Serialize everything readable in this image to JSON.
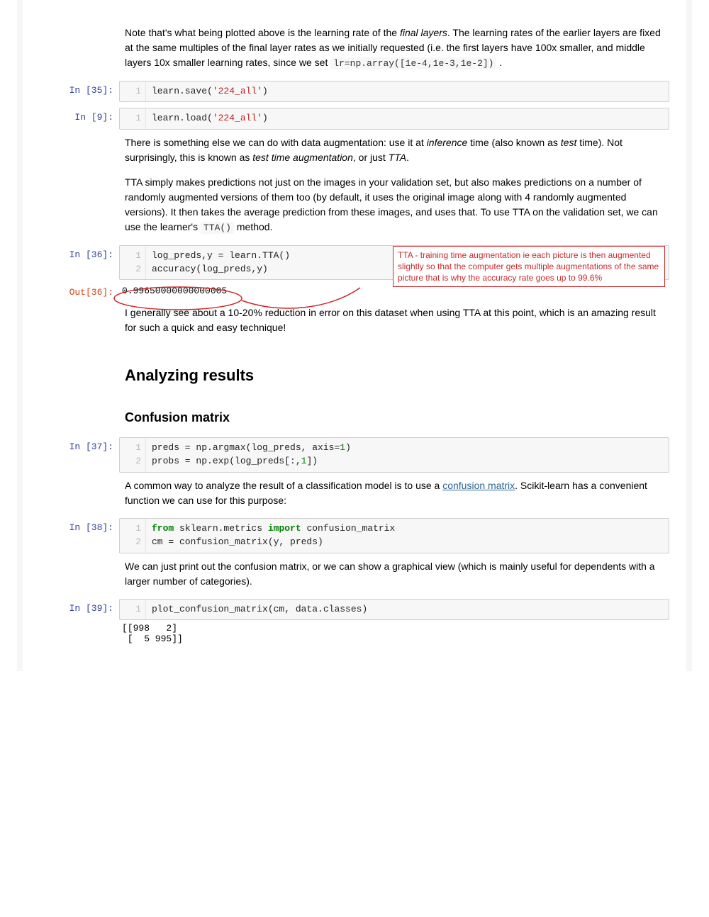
{
  "para1": {
    "pre": "Note that's what being plotted above is the learning rate of the ",
    "em1": "final layers",
    "mid": ". The learning rates of the earlier layers are fixed at the same multiples of the final layer rates as we initially requested (i.e. the first layers have 100x smaller, and middle layers 10x smaller learning rates, since we set ",
    "code": "lr=np.array([1e-4,1e-3,1e-2])",
    "post": " ."
  },
  "cell35": {
    "in_label": "In [35]:",
    "gutter": [
      "1"
    ],
    "code_plain": "learn.save(",
    "str": "'224_all'",
    "code_tail": ")"
  },
  "cell9": {
    "in_label": "In [9]:",
    "gutter": [
      "1"
    ],
    "code_plain": "learn.load(",
    "str": "'224_all'",
    "code_tail": ")"
  },
  "para2": {
    "t1": "There is something else we can do with data augmentation: use it at ",
    "em1": "inference",
    "t2": " time (also known as ",
    "em2": "test",
    "t3": " time). Not surprisingly, this is known as ",
    "em3": "test time augmentation",
    "t4": ", or just ",
    "em4": "TTA",
    "t5": "."
  },
  "para3": {
    "t1": "TTA simply makes predictions not just on the images in your validation set, but also makes predictions on a number of randomly augmented versions of them too (by default, it uses the original image along with 4 randomly augmented versions). It then takes the average prediction from these images, and uses that. To use TTA on the validation set, we can use the learner's ",
    "code": "TTA()",
    "t2": " method."
  },
  "cell36": {
    "in_label": "In [36]:",
    "out_label": "Out[36]:",
    "gutter": [
      "1",
      "2"
    ],
    "line1": "log_preds,y = learn.TTA()",
    "line2": "accuracy(log_preds,y)",
    "out_value": "0.99650000000000005"
  },
  "annotation36": "TTA - training time augmentation ie each picture is then augmented slightly so that the computer gets multiple augmentations of the same picture that is why the accuracy rate goes up to 99.6%",
  "para4": "I generally see about a 10-20% reduction in error on this dataset when using TTA at this point, which is an amazing result for such a quick and easy technique!",
  "heading_analyzing": "Analyzing results",
  "heading_confusion": "Confusion matrix",
  "cell37": {
    "in_label": "In [37]:",
    "gutter": [
      "1",
      "2"
    ],
    "line1_a": "preds = np.argmax(log_preds, axis=",
    "line1_num": "1",
    "line1_b": ")",
    "line2_a": "probs = np.exp(log_preds[:,",
    "line2_num": "1",
    "line2_b": "])"
  },
  "para5": {
    "t1": "A common way to analyze the result of a classification model is to use a ",
    "link": "confusion matrix",
    "t2": ". Scikit-learn has a convenient function we can use for this purpose:"
  },
  "cell38": {
    "in_label": "In [38]:",
    "gutter": [
      "1",
      "2"
    ],
    "l1_kw1": "from",
    "l1_a": " sklearn.metrics ",
    "l1_kw2": "import",
    "l1_b": " confusion_matrix",
    "l2": "cm = confusion_matrix(y, preds)"
  },
  "para6": "We can just print out the confusion matrix, or we can show a graphical view (which is mainly useful for dependents with a larger number of categories).",
  "cell39": {
    "in_label": "In [39]:",
    "gutter": [
      "1"
    ],
    "line1": "plot_confusion_matrix(cm, data.classes)",
    "out": "[[998   2]\n [  5 995]]"
  }
}
